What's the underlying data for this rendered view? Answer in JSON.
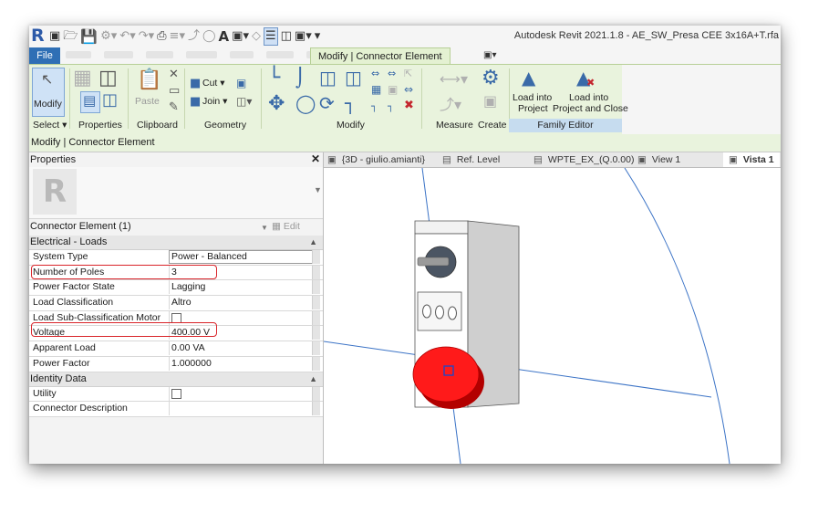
{
  "app": {
    "logo_letter": "R",
    "title": "Autodesk Revit 2021.1.8 - AE_SW_Presa CEE 3x16A+T.rfa"
  },
  "ribbon": {
    "file_tab": "File",
    "context_tab": "Modify | Connector Element",
    "extra_tab": "▣▾",
    "modify_label": "Modify",
    "select_label": "Select ▾",
    "properties_label": "Properties",
    "clipboard_label": "Clipboard",
    "paste_label": "Paste",
    "cut_label": "Cut ▾",
    "join_label": "Join ▾",
    "geometry_label": "Geometry",
    "modify_group_label": "Modify",
    "measure_label": "Measure",
    "create_label": "Create",
    "load_project_line1": "Load into",
    "load_project_line2": "Project",
    "load_close_line1": "Load into",
    "load_close_line2": "Project and Close",
    "family_editor_label": "Family Editor"
  },
  "context_bar": {
    "text": "Modify | Connector Element"
  },
  "properties": {
    "title": "Properties",
    "close_glyph": "✕",
    "type_logo": "R",
    "selector": "Connector Element (1)",
    "edit_type": "Edit Type",
    "sections": [
      {
        "title": "Electrical - Loads",
        "rows": [
          {
            "name": "System Type",
            "value": "Power - Balanced"
          },
          {
            "name": "Number of Poles",
            "value": "3"
          },
          {
            "name": "Power Factor State",
            "value": "Lagging"
          },
          {
            "name": "Load Classification",
            "value": "Altro"
          },
          {
            "name": "Load Sub-Classification Motor",
            "value": ""
          },
          {
            "name": "Voltage",
            "value": "400.00 V"
          },
          {
            "name": "Apparent Load",
            "value": "0.00 VA"
          },
          {
            "name": "Power Factor",
            "value": "1.000000"
          }
        ]
      },
      {
        "title": "Identity Data",
        "rows": [
          {
            "name": "Utility",
            "value": ""
          },
          {
            "name": "Connector Description",
            "value": ""
          }
        ]
      }
    ]
  },
  "view_tabs": [
    {
      "label": "{3D - giulio.amianti}",
      "icon": "3d-view-icon"
    },
    {
      "label": "Ref. Level",
      "icon": "floor-plan-icon"
    },
    {
      "label": "WPTE_EX_(Q.0.00)",
      "icon": "floor-plan-icon"
    },
    {
      "label": "View 1",
      "icon": "3d-view-icon"
    },
    {
      "label": "Vista 1",
      "icon": "3d-view-icon"
    }
  ],
  "colors": {
    "ribbon_bg": "#e9f3dd",
    "file_tab": "#2f6fb5",
    "highlight_red": "#d9242a",
    "plug_red": "#ff1a1a",
    "ref_line_blue": "#3b73c6"
  }
}
